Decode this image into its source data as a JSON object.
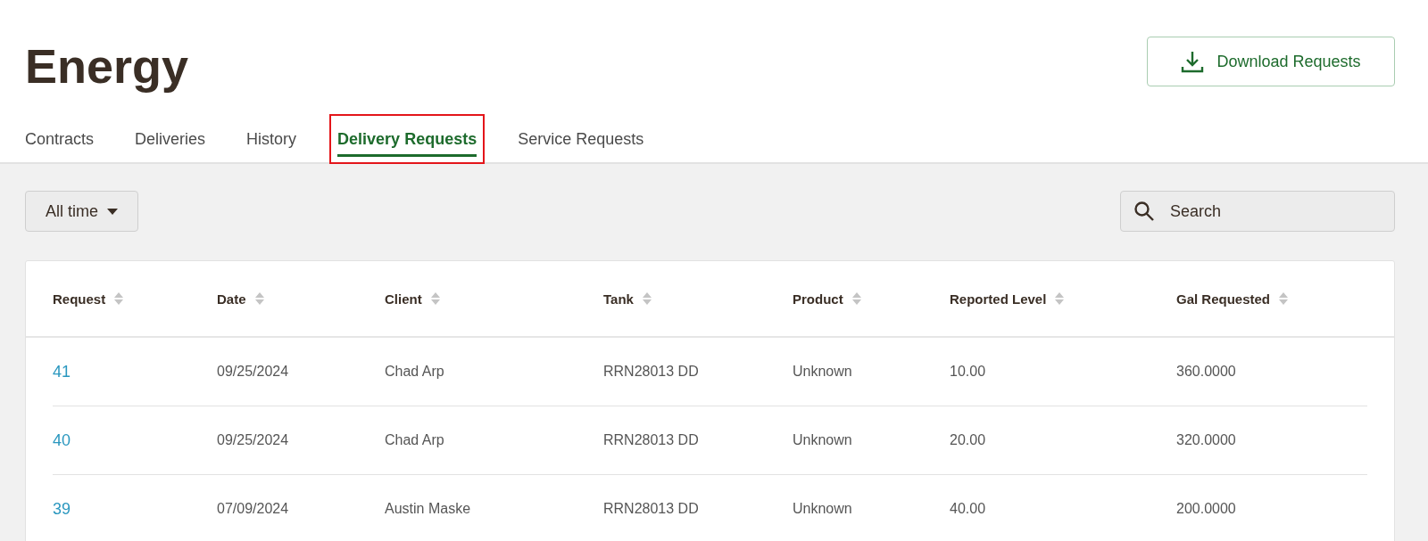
{
  "page": {
    "title": "Energy"
  },
  "download_button": {
    "label": "Download Requests"
  },
  "tabs": [
    {
      "label": "Contracts",
      "selected": false,
      "highlighted": false
    },
    {
      "label": "Deliveries",
      "selected": false,
      "highlighted": false
    },
    {
      "label": "History",
      "selected": false,
      "highlighted": false
    },
    {
      "label": "Delivery Requests",
      "selected": true,
      "highlighted": true
    },
    {
      "label": "Service Requests",
      "selected": false,
      "highlighted": false
    }
  ],
  "filter": {
    "value": "All time"
  },
  "search": {
    "placeholder": "Search"
  },
  "table": {
    "columns": [
      "Request",
      "Date",
      "Client",
      "Tank",
      "Product",
      "Reported Level",
      "Gal Requested"
    ],
    "rows": [
      [
        "41",
        "09/25/2024",
        "Chad Arp",
        "RRN28013 DD",
        "Unknown",
        "10.00",
        "360.0000"
      ],
      [
        "40",
        "09/25/2024",
        "Chad Arp",
        "RRN28013 DD",
        "Unknown",
        "20.00",
        "320.0000"
      ],
      [
        "39",
        "07/09/2024",
        "Austin Maske",
        "RRN28013 DD",
        "Unknown",
        "40.00",
        "200.0000"
      ]
    ]
  }
}
